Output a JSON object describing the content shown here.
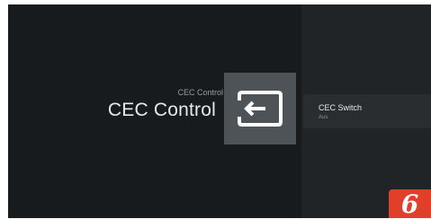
{
  "header": {
    "breadcrumb": "CEC Control",
    "title": "CEC Control"
  },
  "tile": {
    "icon": "input-source-icon"
  },
  "menu": {
    "items": [
      {
        "title": "CEC Switch",
        "subtitle": "Aus"
      }
    ]
  },
  "badge": {
    "number": "6"
  },
  "colors": {
    "background": "#181b1e",
    "panel": "#212426",
    "tile": "#4e5357",
    "badge": "#e0402a"
  }
}
